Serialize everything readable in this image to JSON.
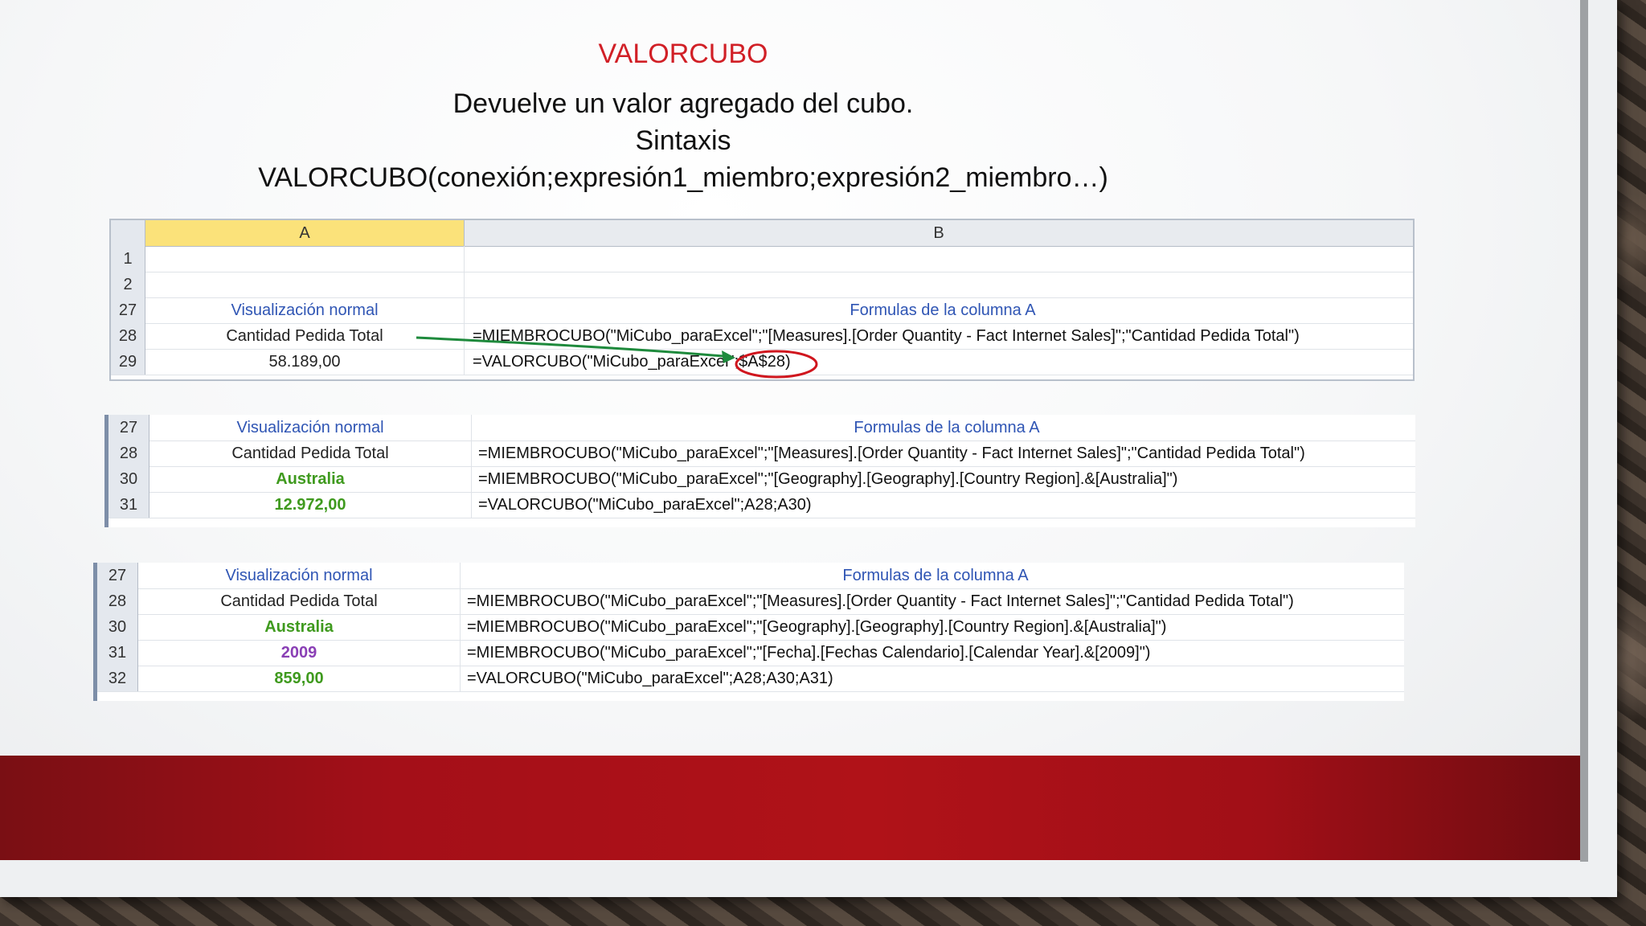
{
  "slide": {
    "title": "VALORCUBO",
    "line1": "Devuelve un valor agregado del cubo.",
    "line2": "Sintaxis",
    "line3": "VALORCUBO(conexión;expresión1_miembro;expresión2_miembro…)"
  },
  "sheet1": {
    "col_a": "A",
    "col_b": "B",
    "rows": [
      {
        "num": "1",
        "a": "",
        "b": ""
      },
      {
        "num": "2",
        "a": "",
        "b": ""
      },
      {
        "num": "27",
        "a": "Visualización normal",
        "b": "Formulas de la columna A"
      },
      {
        "num": "28",
        "a": "Cantidad Pedida Total",
        "b": "=MIEMBROCUBO(\"MiCubo_paraExcel\";\"[Measures].[Order Quantity - Fact Internet Sales]\";\"Cantidad Pedida Total\")"
      },
      {
        "num": "29",
        "a": "58.189,00",
        "b": "=VALORCUBO(\"MiCubo_paraExcel\";$A$28)"
      }
    ]
  },
  "sheet2": {
    "rows": [
      {
        "num": "27",
        "a": "Visualización normal",
        "b": "Formulas de la columna A"
      },
      {
        "num": "28",
        "a": "Cantidad Pedida Total",
        "b": "=MIEMBROCUBO(\"MiCubo_paraExcel\";\"[Measures].[Order Quantity - Fact Internet Sales]\";\"Cantidad Pedida Total\")"
      },
      {
        "num": "30",
        "a": "Australia",
        "b": "=MIEMBROCUBO(\"MiCubo_paraExcel\";\"[Geography].[Geography].[Country Region].&[Australia]\")"
      },
      {
        "num": "31",
        "a": "12.972,00",
        "b": "=VALORCUBO(\"MiCubo_paraExcel\";A28;A30)"
      }
    ]
  },
  "sheet3": {
    "rows": [
      {
        "num": "27",
        "a": "Visualización normal",
        "b": "Formulas de la columna A"
      },
      {
        "num": "28",
        "a": "Cantidad Pedida Total",
        "b": "=MIEMBROCUBO(\"MiCubo_paraExcel\";\"[Measures].[Order Quantity - Fact Internet Sales]\";\"Cantidad Pedida Total\")"
      },
      {
        "num": "30",
        "a": "Australia",
        "b": "=MIEMBROCUBO(\"MiCubo_paraExcel\";\"[Geography].[Geography].[Country Region].&[Australia]\")"
      },
      {
        "num": "31",
        "a": "2009",
        "b": "=MIEMBROCUBO(\"MiCubo_paraExcel\";\"[Fecha].[Fechas Calendario].[Calendar Year].&[2009]\")"
      },
      {
        "num": "32",
        "a": "859,00",
        "b": "=VALORCUBO(\"MiCubo_paraExcel\";A28;A30;A31)"
      }
    ]
  },
  "colors": {
    "title_red": "#d11f26",
    "header_blue": "#2f55b4",
    "value_green": "#3f9a1e",
    "year_purple": "#8a3fb5",
    "arrow_green": "#1e8a3c",
    "circle_red": "#d0161e",
    "band_red": "#b01218"
  }
}
